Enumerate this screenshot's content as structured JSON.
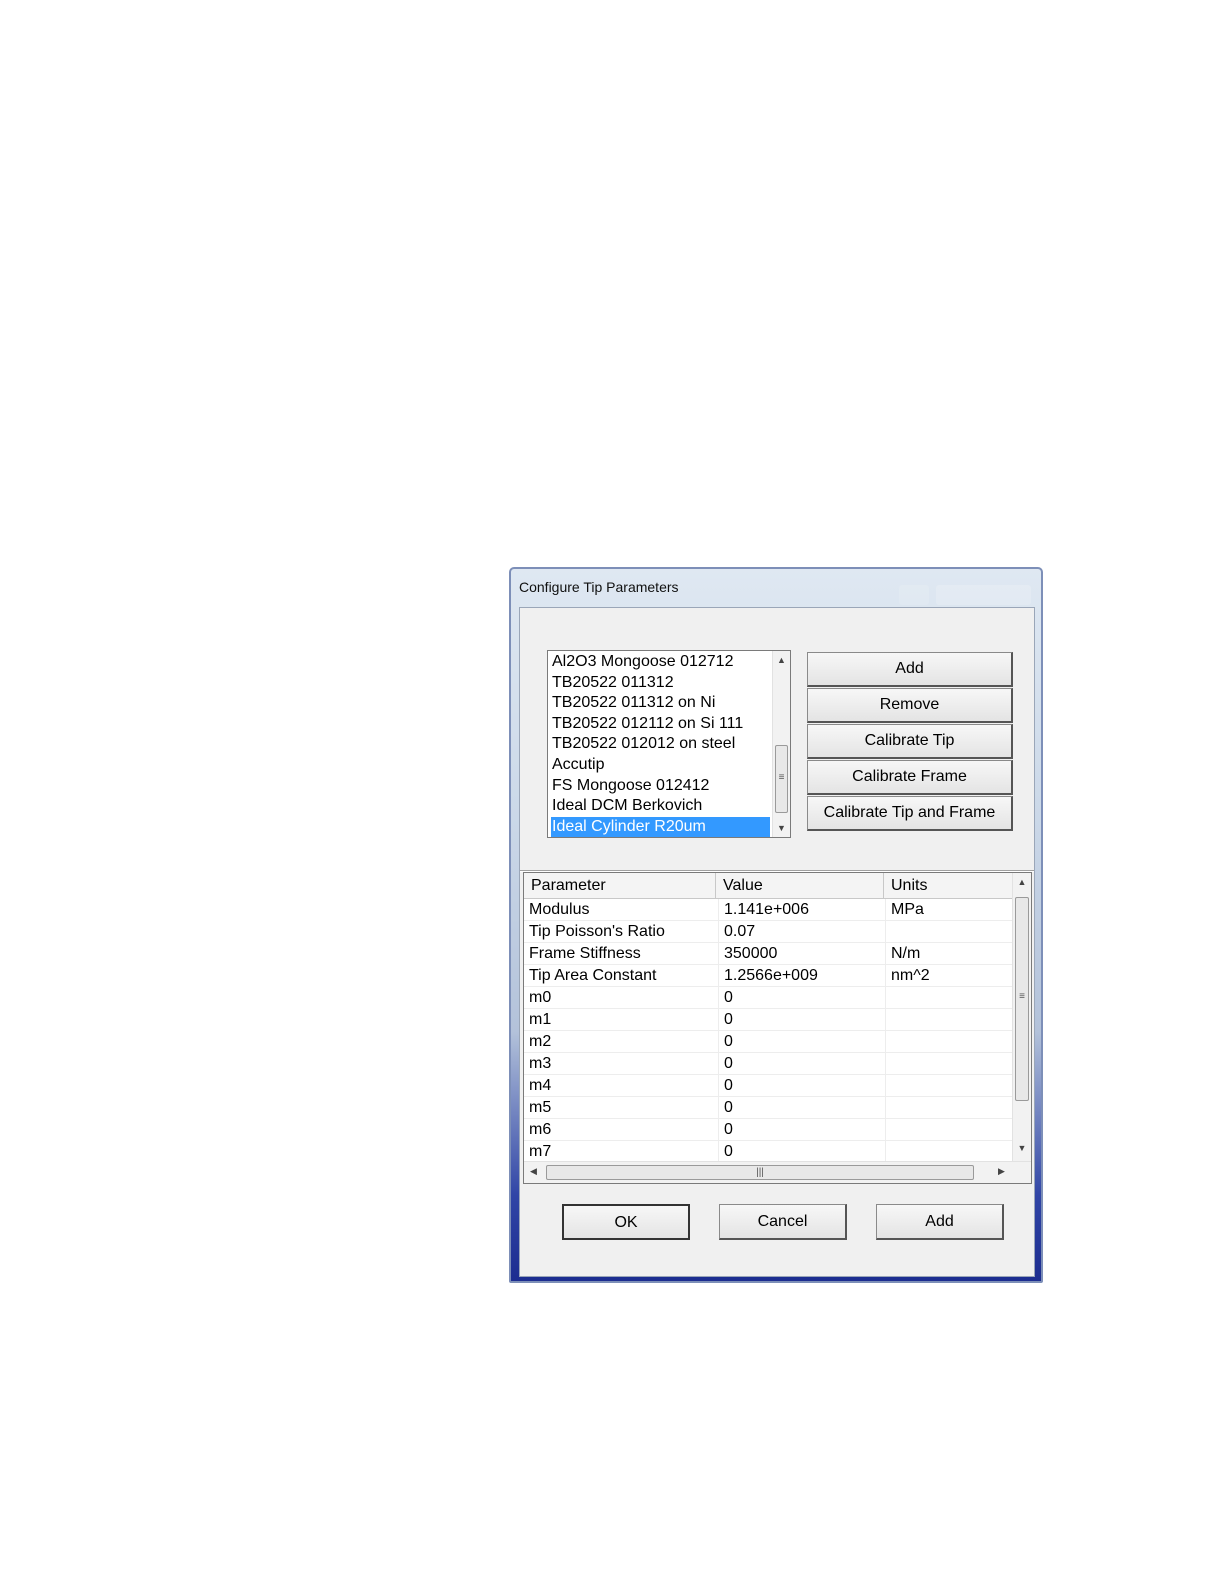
{
  "window": {
    "title": "Configure Tip Parameters"
  },
  "tip_list": {
    "items": [
      "Al2O3 Mongoose 012712",
      "TB20522 011312",
      "TB20522 011312 on Ni",
      "TB20522 012112 on Si 111",
      "TB20522 012012 on steel",
      "Accutip",
      "FS Mongoose 012412",
      "Ideal DCM Berkovich",
      "Ideal Cylinder R20um"
    ],
    "selected": "Ideal Cylinder R20um"
  },
  "side_buttons": {
    "add": "Add",
    "remove": "Remove",
    "calibrate_tip": "Calibrate Tip",
    "calibrate_frame": "Calibrate Frame",
    "calibrate_tip_and_frame": "Calibrate Tip and Frame"
  },
  "param_table": {
    "headers": {
      "parameter": "Parameter",
      "value": "Value",
      "units": "Units"
    },
    "rows": [
      {
        "parameter": "Modulus",
        "value": "1.141e+006",
        "units": "MPa"
      },
      {
        "parameter": "Tip Poisson's Ratio",
        "value": "0.07",
        "units": ""
      },
      {
        "parameter": "Frame Stiffness",
        "value": "350000",
        "units": "N/m"
      },
      {
        "parameter": "Tip Area Constant",
        "value": "1.2566e+009",
        "units": "nm^2"
      },
      {
        "parameter": "m0",
        "value": "0",
        "units": ""
      },
      {
        "parameter": "m1",
        "value": "0",
        "units": ""
      },
      {
        "parameter": "m2",
        "value": "0",
        "units": ""
      },
      {
        "parameter": "m3",
        "value": "0",
        "units": ""
      },
      {
        "parameter": "m4",
        "value": "0",
        "units": ""
      },
      {
        "parameter": "m5",
        "value": "0",
        "units": ""
      },
      {
        "parameter": "m6",
        "value": "0",
        "units": ""
      },
      {
        "parameter": "m7",
        "value": "0",
        "units": ""
      }
    ]
  },
  "footer_buttons": {
    "ok": "OK",
    "cancel": "Cancel",
    "add": "Add"
  }
}
